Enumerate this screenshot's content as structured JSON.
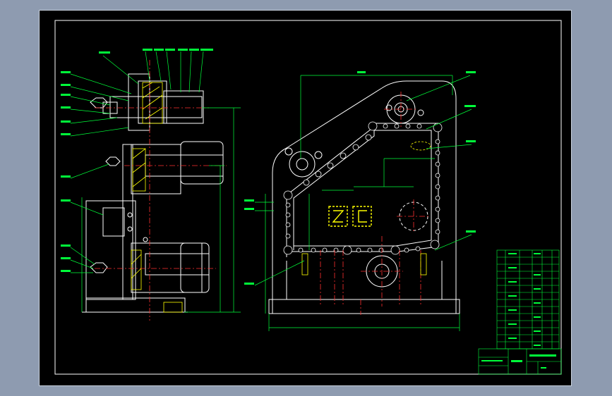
{
  "drawing": {
    "title_center_text": "Z C",
    "colors": {
      "background": "#8e9bb0",
      "canvas": "#000000",
      "outline": "#ffffff",
      "dimension": "#00ff3a",
      "center_line": "#ff3030",
      "hatch": "#ffff00",
      "accent": "#ff00ff",
      "leader": "#00ffff"
    }
  }
}
